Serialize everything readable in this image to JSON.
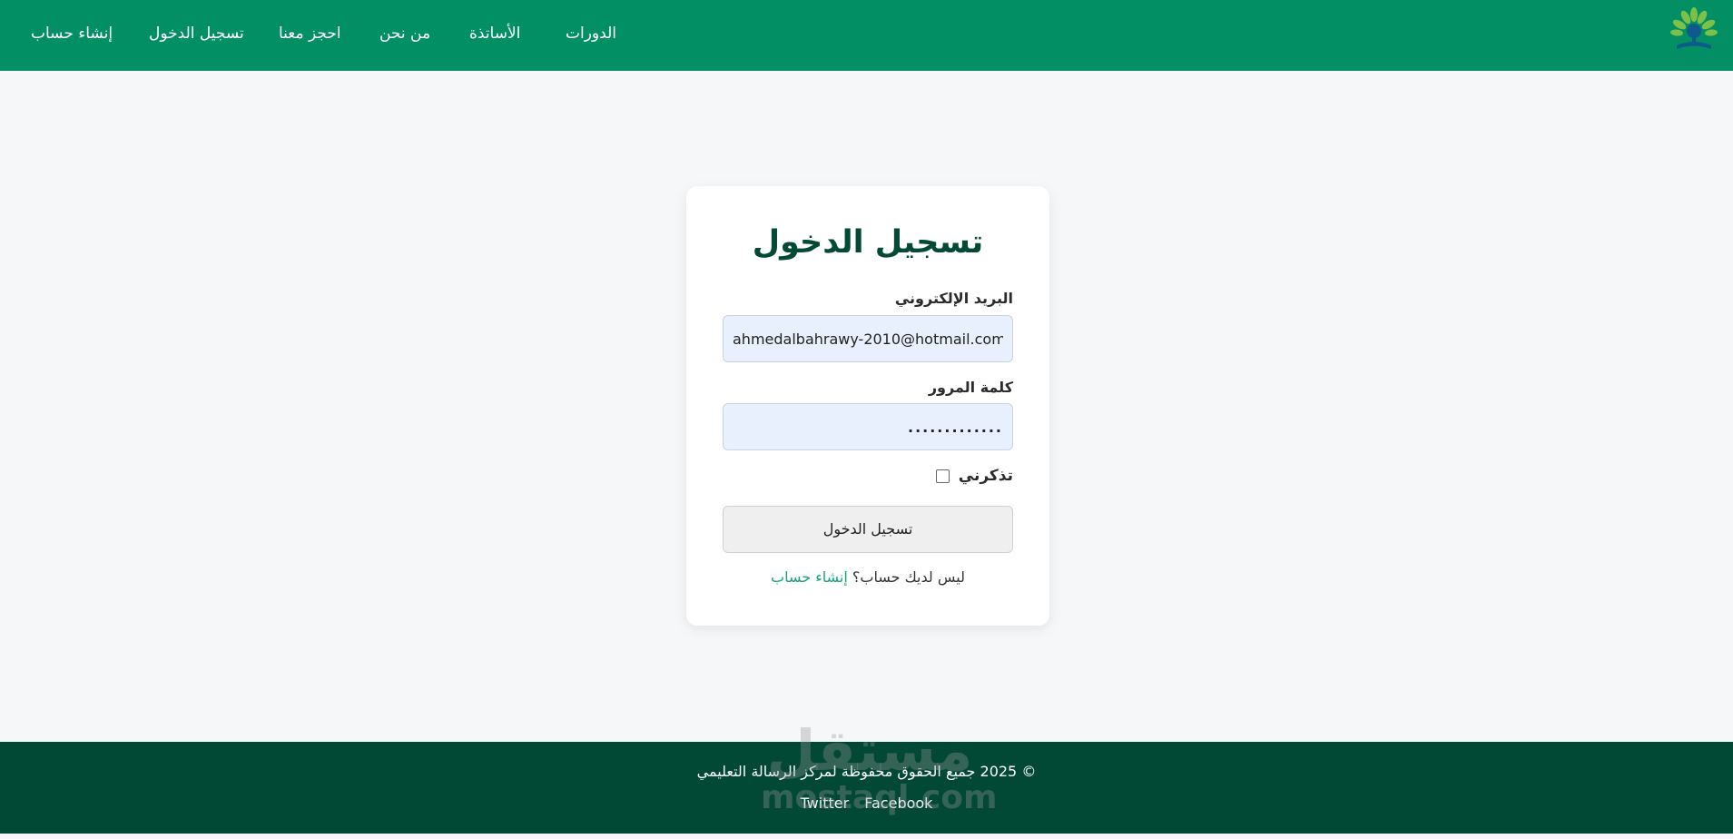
{
  "header": {
    "nav": [
      {
        "id": "courses",
        "label": "الدورات"
      },
      {
        "id": "teachers",
        "label": "الأساتذة"
      },
      {
        "id": "about",
        "label": "من نحن"
      },
      {
        "id": "book",
        "label": "احجز معنا"
      },
      {
        "id": "login",
        "label": "تسجيل الدخول"
      },
      {
        "id": "register",
        "label": "إنشاء حساب"
      }
    ],
    "logo_icon": "tree-logo-icon"
  },
  "login_card": {
    "title": "تسجيل الدخول",
    "email_label": "البريد الإلكتروني",
    "email_value": "ahmedalbahrawy-2010@hotmail.com",
    "password_label": "كلمة المرور",
    "password_value": ".............",
    "remember_label": "تذكرني",
    "remember_checked": false,
    "submit_label": "تسجيل الدخول",
    "no_account_text": "ليس لديك حساب؟",
    "signup_link": "إنشاء حساب"
  },
  "footer": {
    "copyright": "© 2025 جميع الحقوق محفوظة لمركز الرسالة التعليمي",
    "links": [
      "Twitter",
      "Facebook"
    ]
  },
  "watermark": {
    "arabic": "مستقل",
    "latin": "mostaql.com"
  },
  "colors": {
    "header_bg": "#028f63",
    "footer_bg": "#024935",
    "title": "#024a36",
    "link": "#15a37b",
    "page_bg": "#f6f7f9"
  }
}
